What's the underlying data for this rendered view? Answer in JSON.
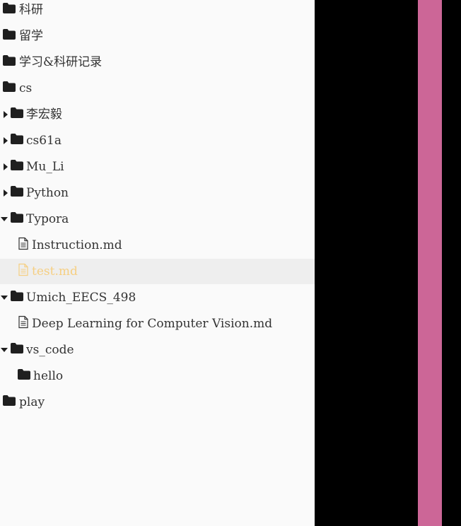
{
  "file_tree": {
    "items": [
      {
        "label": "科研",
        "type": "folder",
        "expander": "none"
      },
      {
        "label": "留学",
        "type": "folder",
        "expander": "none"
      },
      {
        "label": "学习&科研记录",
        "type": "folder",
        "expander": "none"
      },
      {
        "label": "cs",
        "type": "folder",
        "expander": "none"
      },
      {
        "label": "李宏毅",
        "type": "folder",
        "expander": "collapsed"
      },
      {
        "label": "cs61a",
        "type": "folder",
        "expander": "collapsed"
      },
      {
        "label": "Mu_Li",
        "type": "folder",
        "expander": "collapsed"
      },
      {
        "label": "Python",
        "type": "folder",
        "expander": "collapsed"
      },
      {
        "label": "Typora",
        "type": "folder",
        "expander": "expanded"
      },
      {
        "label": "Instruction.md",
        "type": "file",
        "expander": "none"
      },
      {
        "label": "test.md",
        "type": "file",
        "expander": "none",
        "active": true
      },
      {
        "label": "Umich_EECS_498",
        "type": "folder",
        "expander": "expanded"
      },
      {
        "label": "Deep Learning for Computer Vision.md",
        "type": "file",
        "expander": "none"
      },
      {
        "label": "vs_code",
        "type": "folder",
        "expander": "expanded"
      },
      {
        "label": "hello",
        "type": "folder",
        "expander": "none"
      },
      {
        "label": "play",
        "type": "folder",
        "expander": "none"
      }
    ]
  },
  "colors": {
    "sidebar_bg": "#fafafa",
    "active_row_bg": "#eeeeee",
    "active_text": "#f6cf82",
    "text": "#333333",
    "icon": "#1f1f1f",
    "accent_bar": "#cc6697",
    "background": "#000000"
  }
}
